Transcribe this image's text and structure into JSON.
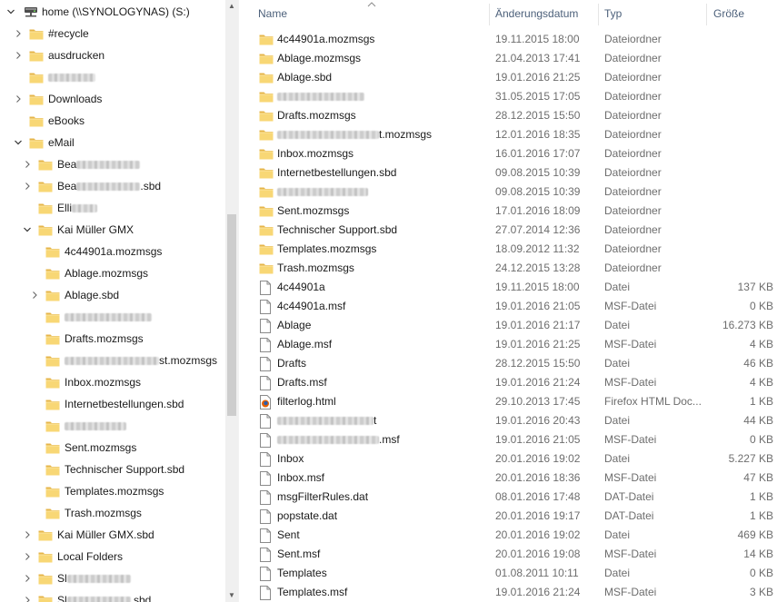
{
  "tree": {
    "root": {
      "label": "home (\\\\SYNOLOGYNAS) (S:)"
    },
    "items": [
      {
        "label": "#recycle",
        "indent": 0,
        "chevron": "right"
      },
      {
        "label": "ausdrucken",
        "indent": 0,
        "chevron": "right"
      },
      {
        "label": "",
        "indent": 0,
        "chevron": "none",
        "blur": 52
      },
      {
        "label": "Downloads",
        "indent": 0,
        "chevron": "right"
      },
      {
        "label": "eBooks",
        "indent": 0,
        "chevron": "none"
      },
      {
        "label": "eMail",
        "indent": 0,
        "chevron": "down"
      },
      {
        "label": "Bea",
        "indent": 1,
        "chevron": "right",
        "blur": 70
      },
      {
        "label": "Bea",
        "indent": 1,
        "chevron": "right",
        "blur": 70,
        "suffix": ".sbd"
      },
      {
        "label": "Elli",
        "indent": 1,
        "chevron": "none",
        "blur": 28
      },
      {
        "label": "Kai Müller GMX",
        "indent": 1,
        "chevron": "down"
      },
      {
        "label": "4c44901a.mozmsgs",
        "indent": 2,
        "chevron": "none"
      },
      {
        "label": "Ablage.mozmsgs",
        "indent": 2,
        "chevron": "none"
      },
      {
        "label": "Ablage.sbd",
        "indent": 2,
        "chevron": "right"
      },
      {
        "label": "",
        "indent": 2,
        "chevron": "none",
        "blur": 96
      },
      {
        "label": "Drafts.mozmsgs",
        "indent": 2,
        "chevron": "none"
      },
      {
        "label": "",
        "indent": 2,
        "chevron": "none",
        "blur": 104,
        "suffix": "st.mozmsgs"
      },
      {
        "label": "Inbox.mozmsgs",
        "indent": 2,
        "chevron": "none"
      },
      {
        "label": "Internetbestellungen.sbd",
        "indent": 2,
        "chevron": "none"
      },
      {
        "label": "",
        "indent": 2,
        "chevron": "none",
        "blur": 68
      },
      {
        "label": "Sent.mozmsgs",
        "indent": 2,
        "chevron": "none"
      },
      {
        "label": "Technischer Support.sbd",
        "indent": 2,
        "chevron": "none"
      },
      {
        "label": "Templates.mozmsgs",
        "indent": 2,
        "chevron": "none"
      },
      {
        "label": "Trash.mozmsgs",
        "indent": 2,
        "chevron": "none"
      },
      {
        "label": "Kai Müller GMX.sbd",
        "indent": 1,
        "chevron": "right"
      },
      {
        "label": "Local Folders",
        "indent": 1,
        "chevron": "right"
      },
      {
        "label": "Sl",
        "indent": 1,
        "chevron": "right",
        "blur": 70
      },
      {
        "label": "Sl",
        "indent": 1,
        "chevron": "right",
        "blur": 70,
        "suffix": ".sbd"
      }
    ]
  },
  "list": {
    "columns": {
      "name": "Name",
      "date": "Änderungsdatum",
      "type": "Typ",
      "size": "Größe"
    },
    "rows": [
      {
        "name": "4c44901a.mozmsgs",
        "date": "19.11.2015 18:00",
        "type": "Dateiordner",
        "size": "",
        "icon": "folder"
      },
      {
        "name": "Ablage.mozmsgs",
        "date": "21.04.2013 17:41",
        "type": "Dateiordner",
        "size": "",
        "icon": "folder"
      },
      {
        "name": "Ablage.sbd",
        "date": "19.01.2016 21:25",
        "type": "Dateiordner",
        "size": "",
        "icon": "folder"
      },
      {
        "name": "",
        "date": "31.05.2015 17:05",
        "type": "Dateiordner",
        "size": "",
        "icon": "folder",
        "blur": 96
      },
      {
        "name": "Drafts.mozmsgs",
        "date": "28.12.2015 15:50",
        "type": "Dateiordner",
        "size": "",
        "icon": "folder"
      },
      {
        "name": "",
        "date": "12.01.2016 18:35",
        "type": "Dateiordner",
        "size": "",
        "icon": "folder",
        "blur": 112,
        "suffix": "t.mozmsgs"
      },
      {
        "name": "Inbox.mozmsgs",
        "date": "16.01.2016 17:07",
        "type": "Dateiordner",
        "size": "",
        "icon": "folder"
      },
      {
        "name": "Internetbestellungen.sbd",
        "date": "09.08.2015 10:39",
        "type": "Dateiordner",
        "size": "",
        "icon": "folder"
      },
      {
        "name": "",
        "date": "09.08.2015 10:39",
        "type": "Dateiordner",
        "size": "",
        "icon": "folder",
        "blur": 100
      },
      {
        "name": "Sent.mozmsgs",
        "date": "17.01.2016 18:09",
        "type": "Dateiordner",
        "size": "",
        "icon": "folder"
      },
      {
        "name": "Technischer Support.sbd",
        "date": "27.07.2014 12:36",
        "type": "Dateiordner",
        "size": "",
        "icon": "folder"
      },
      {
        "name": "Templates.mozmsgs",
        "date": "18.09.2012 11:32",
        "type": "Dateiordner",
        "size": "",
        "icon": "folder"
      },
      {
        "name": "Trash.mozmsgs",
        "date": "24.12.2015 13:28",
        "type": "Dateiordner",
        "size": "",
        "icon": "folder"
      },
      {
        "name": "4c44901a",
        "date": "19.11.2015 18:00",
        "type": "Datei",
        "size": "137 KB",
        "icon": "file"
      },
      {
        "name": "4c44901a.msf",
        "date": "19.01.2016 21:05",
        "type": "MSF-Datei",
        "size": "0 KB",
        "icon": "file"
      },
      {
        "name": "Ablage",
        "date": "19.01.2016 21:17",
        "type": "Datei",
        "size": "16.273 KB",
        "icon": "file"
      },
      {
        "name": "Ablage.msf",
        "date": "19.01.2016 21:25",
        "type": "MSF-Datei",
        "size": "4 KB",
        "icon": "file"
      },
      {
        "name": "Drafts",
        "date": "28.12.2015 15:50",
        "type": "Datei",
        "size": "46 KB",
        "icon": "file"
      },
      {
        "name": "Drafts.msf",
        "date": "19.01.2016 21:24",
        "type": "MSF-Datei",
        "size": "4 KB",
        "icon": "file"
      },
      {
        "name": "filterlog.html",
        "date": "29.10.2013 17:45",
        "type": "Firefox HTML Doc...",
        "size": "1 KB",
        "icon": "firefox"
      },
      {
        "name": "",
        "date": "19.01.2016 20:43",
        "type": "Datei",
        "size": "44 KB",
        "icon": "file",
        "blur": 106,
        "suffix": "t"
      },
      {
        "name": "",
        "date": "19.01.2016 21:05",
        "type": "MSF-Datei",
        "size": "0 KB",
        "icon": "file",
        "blur": 112,
        "suffix": ".msf"
      },
      {
        "name": "Inbox",
        "date": "20.01.2016 19:02",
        "type": "Datei",
        "size": "5.227 KB",
        "icon": "file"
      },
      {
        "name": "Inbox.msf",
        "date": "20.01.2016 18:36",
        "type": "MSF-Datei",
        "size": "47 KB",
        "icon": "file"
      },
      {
        "name": "msgFilterRules.dat",
        "date": "08.01.2016 17:48",
        "type": "DAT-Datei",
        "size": "1 KB",
        "icon": "file"
      },
      {
        "name": "popstate.dat",
        "date": "20.01.2016 19:17",
        "type": "DAT-Datei",
        "size": "1 KB",
        "icon": "file"
      },
      {
        "name": "Sent",
        "date": "20.01.2016 19:02",
        "type": "Datei",
        "size": "469 KB",
        "icon": "file"
      },
      {
        "name": "Sent.msf",
        "date": "20.01.2016 19:08",
        "type": "MSF-Datei",
        "size": "14 KB",
        "icon": "file"
      },
      {
        "name": "Templates",
        "date": "01.08.2011 10:11",
        "type": "Datei",
        "size": "0 KB",
        "icon": "file"
      },
      {
        "name": "Templates.msf",
        "date": "19.01.2016 21:24",
        "type": "MSF-Datei",
        "size": "3 KB",
        "icon": "file"
      }
    ]
  },
  "icons": {
    "folder": "folder-icon",
    "file": "file-icon",
    "firefox": "firefox-html-icon",
    "drive": "network-drive-icon",
    "chevron_right": "chevron-right-icon",
    "chevron_down": "chevron-down-icon"
  },
  "colors": {
    "folder": "#f8d775",
    "folder_dark": "#e6b54a",
    "header_text": "#4c607a",
    "secondary_text": "#6d6d6d"
  }
}
